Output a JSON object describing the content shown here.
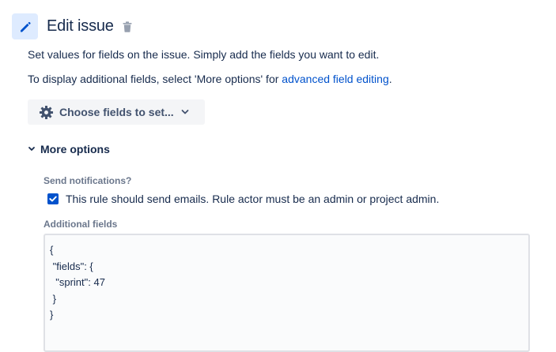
{
  "header": {
    "title": "Edit issue",
    "edit_icon": "pencil-icon",
    "delete_icon": "trash-icon"
  },
  "description": {
    "line1": "Set values for fields on the issue. Simply add the fields you want to edit.",
    "line2_prefix": "To display additional fields, select 'More options' for ",
    "line2_link": "advanced field editing",
    "line2_suffix": "."
  },
  "choose_fields": {
    "label": "Choose fields to set...",
    "icon": "gear-icon",
    "chevron": "chevron-down-icon"
  },
  "more_options": {
    "label": "More options",
    "icon": "chevron-down-icon"
  },
  "notifications": {
    "label": "Send notifications?",
    "checkbox_label": "This rule should send emails. Rule actor must be an admin or project admin.",
    "checked": true
  },
  "additional_fields": {
    "label": "Additional fields",
    "lines": [
      "{",
      " \"fields\": {",
      "  \"sprint\": 47",
      " }",
      "}"
    ]
  },
  "colors": {
    "accent": "#0052cc",
    "icon_bg": "#deebff",
    "text": "#172b4d",
    "muted": "#6b778c",
    "button_bg": "#f4f5f7"
  }
}
